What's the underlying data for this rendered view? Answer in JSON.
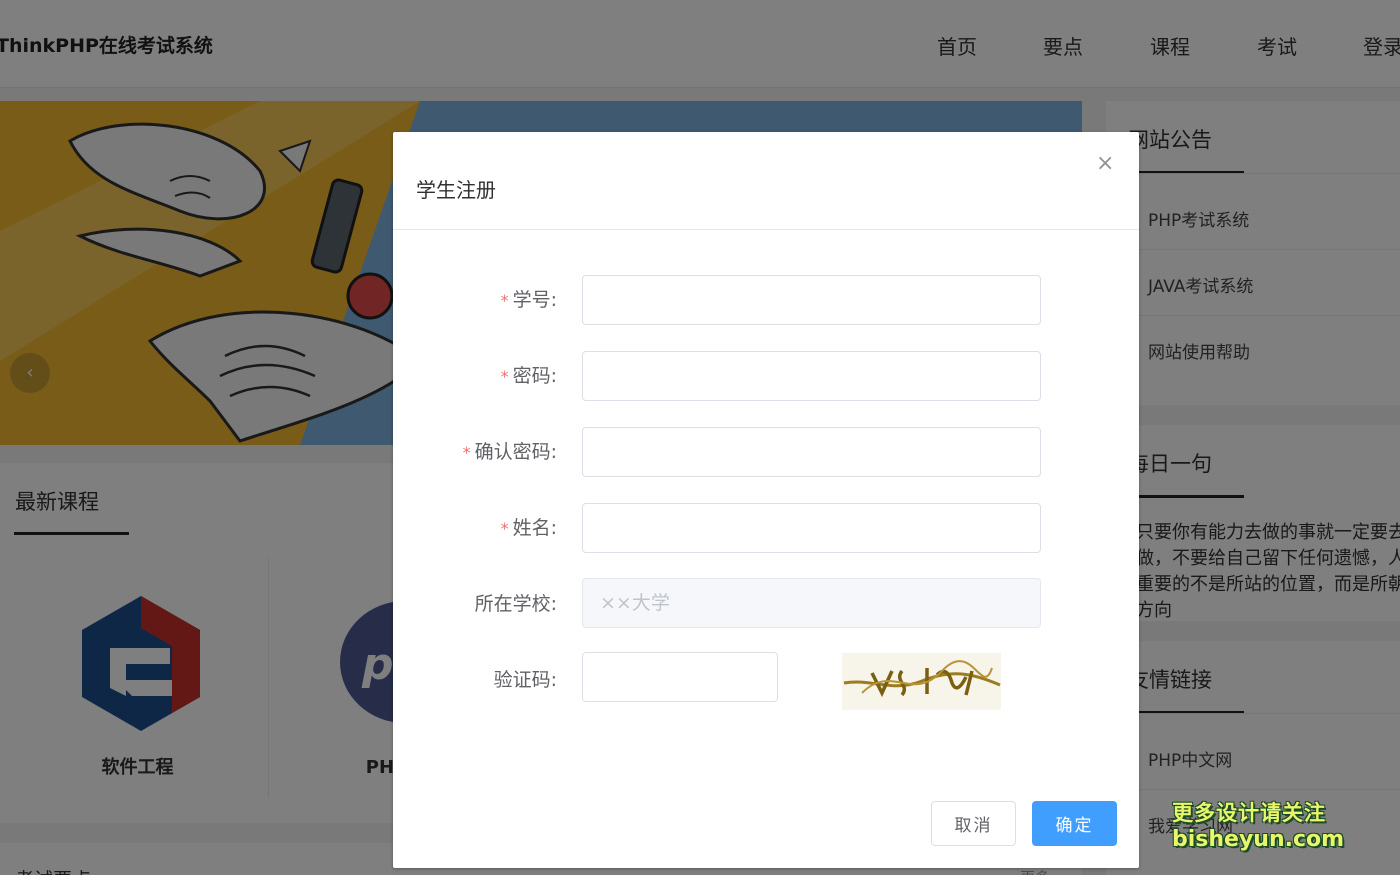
{
  "header": {
    "site_title": "ThinkPHP在线考试系统",
    "nav": [
      "首页",
      "要点",
      "课程",
      "考试",
      "登录"
    ]
  },
  "banner": {
    "prev_icon": "chevron-left-icon",
    "prev_glyph": "‹"
  },
  "courses": {
    "title": "最新课程",
    "items": [
      {
        "name": "软件工程",
        "icon": "software-engineering-logo"
      },
      {
        "name": "PHP动态",
        "icon": "php-logo"
      }
    ]
  },
  "exam_section": {
    "title": "考试要点",
    "more": "更多"
  },
  "announcements": {
    "title": "网站公告",
    "items": [
      "PHP考试系统",
      "JAVA考试系统",
      "网站使用帮助"
    ]
  },
  "daily_quote": {
    "title": "每日一句",
    "text": "只要你有能力去做的事就一定要去做，不要给自己留下任何遗憾，人生重要的不是所站的位置，而是所朝的方向"
  },
  "links": {
    "title": "友情链接",
    "items": [
      "PHP中文网",
      "我爱学习网"
    ]
  },
  "dialog": {
    "title": "学生注册",
    "close_glyph": "×",
    "required_mark": "*",
    "fields": {
      "student_id": {
        "label": "学号:",
        "value": "",
        "placeholder": ""
      },
      "password": {
        "label": "密码:",
        "value": "",
        "placeholder": ""
      },
      "confirm_password": {
        "label": "确认密码:",
        "value": "",
        "placeholder": ""
      },
      "name": {
        "label": "姓名:",
        "value": "",
        "placeholder": ""
      },
      "school": {
        "label": "所在学校:",
        "value": "",
        "placeholder": "××大学"
      },
      "captcha": {
        "label": "验证码:",
        "value": "",
        "placeholder": ""
      }
    },
    "cancel_label": "取消",
    "confirm_label": "确定"
  },
  "colors": {
    "primary": "#409eff",
    "required": "#f56c6c",
    "overlay": "rgba(0,0,0,0.5)"
  },
  "watermark": {
    "line1": "更多设计请关注",
    "line2": "bisheyun.com"
  }
}
